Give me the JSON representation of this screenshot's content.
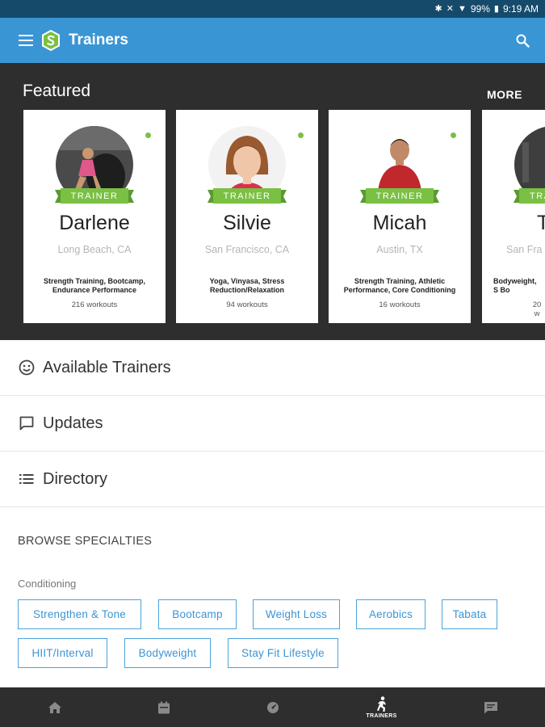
{
  "status_bar": {
    "battery": "99%",
    "time": "9:19 AM"
  },
  "app_bar": {
    "title": "Trainers"
  },
  "featured": {
    "title": "Featured",
    "more_label": "MORE",
    "badge_label": "TRAINER",
    "cards": [
      {
        "name": "Darlene",
        "location": "Long Beach, CA",
        "specialties": "Strength Training, Bootcamp, Endurance Performance",
        "workouts": "216 workouts"
      },
      {
        "name": "Silvie",
        "location": "San Francisco, CA",
        "specialties": "Yoga, Vinyasa, Stress Reduction/Relaxation",
        "workouts": "94 workouts"
      },
      {
        "name": "Micah",
        "location": "Austin, TX",
        "specialties": "Strength Training, Athletic Performance, Core Conditioning",
        "workouts": "16 workouts"
      },
      {
        "name": "T",
        "location": "San Fra",
        "specialties": "Bodyweight, S Bo",
        "workouts": "20 w"
      }
    ]
  },
  "list": {
    "items": [
      {
        "label": "Available Trainers",
        "icon": "smiley-icon"
      },
      {
        "label": "Updates",
        "icon": "chat-bubble-icon"
      },
      {
        "label": "Directory",
        "icon": "list-icon"
      }
    ]
  },
  "browse": {
    "title": "BROWSE SPECIALTIES",
    "category": "Conditioning",
    "chips": [
      "Strengthen & Tone",
      "Bootcamp",
      "Weight Loss",
      "Aerobics",
      "Tabata",
      "HIIT/Interval",
      "Bodyweight",
      "Stay Fit Lifestyle"
    ]
  },
  "bottom_nav": {
    "active_label": "TRAINERS",
    "items": [
      "home-icon",
      "calendar-icon",
      "dashboard-icon",
      "trainers-icon",
      "messages-icon"
    ]
  },
  "colors": {
    "primary": "#3a95d4",
    "status_bar": "#164a6b",
    "dark": "#2e2e2e",
    "accent_green": "#7ac043"
  }
}
